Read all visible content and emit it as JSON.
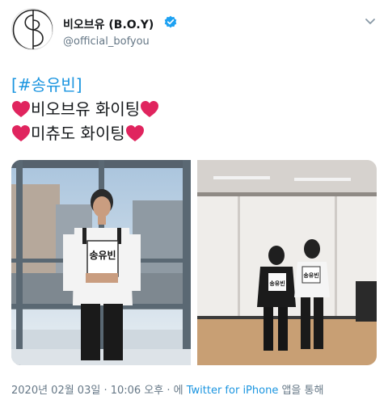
{
  "author": {
    "display_name": "비오브유 (B.O.Y)",
    "handle": "@official_bofyou",
    "verified": true
  },
  "tweet": {
    "hashtag_open": "[",
    "hashtag": "#송유빈",
    "hashtag_close": "]",
    "line2": "비오브유 화이팅",
    "line3": "미츄도 화이팅"
  },
  "media": {
    "left_name_tag": "송유빈",
    "right_name_tag_a": "송유빈",
    "right_name_tag_b": "송유빈"
  },
  "meta": {
    "timestamp": "2020년 02월 03일 · 10:06 오후 · 에",
    "source": "Twitter for iPhone",
    "suffix": "앱을 통해"
  },
  "colors": {
    "link": "#1b95e0",
    "secondary_text": "#657786",
    "heart": "#e0245e",
    "verified": "#1da1f2"
  },
  "icons": [
    "logo-icon",
    "verified-icon",
    "chevron-down-icon",
    "heart-icon"
  ]
}
